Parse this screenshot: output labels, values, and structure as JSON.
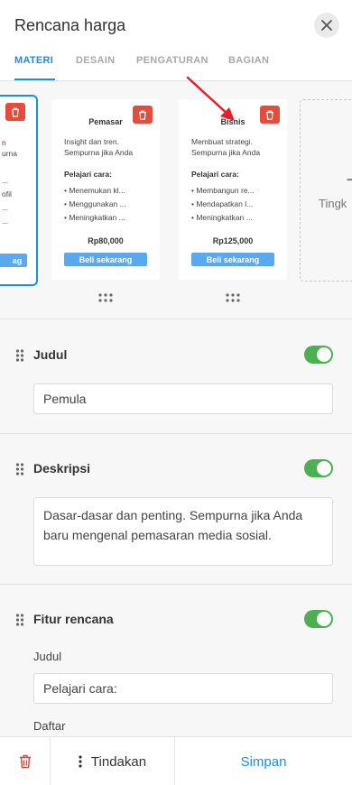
{
  "header": {
    "title": "Rencana harga",
    "tabs": [
      {
        "label": "MATERI",
        "active": true
      },
      {
        "label": "DESAIN",
        "active": false
      },
      {
        "label": "PENGATURAN",
        "active": false
      },
      {
        "label": "BAGIAN",
        "active": false
      }
    ]
  },
  "plans": [
    {
      "name": "",
      "desc_lines": [
        "n",
        "urna"
      ],
      "features_title": "",
      "features": [
        "",
        "ofil",
        ""
      ],
      "price": "",
      "buy_label": "ag",
      "selected": true
    },
    {
      "name": "Pemasar",
      "desc_lines": [
        "Insight dan tren.",
        "Sempurna jika Anda"
      ],
      "features_title": "Pelajari cara:",
      "features": [
        "• Menemukan kl...",
        "• Menggunakan ...",
        "• Meningkatkan ..."
      ],
      "price": "Rp80,000",
      "buy_label": "Beli sekarang",
      "selected": false
    },
    {
      "name": "Bisnis",
      "desc_lines": [
        "Membuat strategi.",
        "Sempurna jika Anda"
      ],
      "features_title": "Pelajari cara:",
      "features": [
        "• Membangun re...",
        "• Mendapatkan l...",
        "• Meningkatkan ..."
      ],
      "price": "Rp125,000",
      "buy_label": "Beli sekarang",
      "selected": false
    }
  ],
  "add_card": {
    "plus": "+",
    "label": "Tingk"
  },
  "sections": {
    "judul": {
      "title": "Judul",
      "value": "Pemula",
      "enabled": true
    },
    "deskripsi": {
      "title": "Deskripsi",
      "value": "Dasar-dasar dan penting. Sempurna jika Anda baru mengenal pemasaran media sosial.",
      "enabled": true
    },
    "fitur": {
      "title": "Fitur rencana",
      "enabled": true,
      "judul_label": "Judul",
      "judul_value": "Pelajari cara:",
      "daftar_label": "Daftar"
    }
  },
  "footer": {
    "actions_label": "Tindakan",
    "save_label": "Simpan"
  },
  "colors": {
    "accent": "#1a8fe3",
    "delete": "#e64c3c",
    "toggle_on": "#4caf50",
    "buy": "#5aa9ef",
    "annotation_arrow": "#e5202a"
  },
  "icons": [
    "close-icon",
    "trash-icon",
    "drag-handle-icon",
    "kebab-menu-icon",
    "plus-icon",
    "annotation-arrow-icon"
  ]
}
